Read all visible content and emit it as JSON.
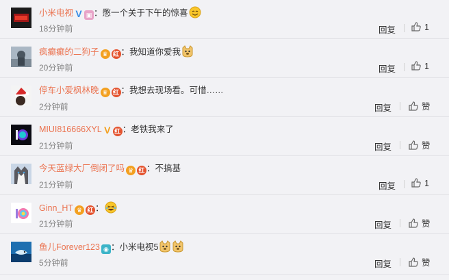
{
  "colors": {
    "username": "#eb7350",
    "text": "#333333",
    "time": "#808080",
    "background": "#f2f2f5"
  },
  "comments": [
    {
      "user": "小米电视",
      "badges": [
        "verified-v-badge",
        "tv-member-badge"
      ],
      "separator": "：",
      "text": "憋一个关于下午的惊喜",
      "emojis": [
        "smile-emoji"
      ],
      "time": "18分钟前",
      "reply_label": "回复",
      "like_count": "1"
    },
    {
      "user": "疯癫癫的二狗子",
      "badges": [
        "crown-badge",
        "red-badge"
      ],
      "separator": "：",
      "text": "我知道你爱我",
      "emojis": [
        "doge-emoji"
      ],
      "time": "20分钟前",
      "reply_label": "回复",
      "like_count": "1"
    },
    {
      "user": "停车小爱枫林晚",
      "badges": [
        "crown-badge",
        "red-badge"
      ],
      "separator": "：",
      "text": "我想去现场看。可惜……",
      "emojis": [],
      "time": "2分钟前",
      "reply_label": "回复",
      "like_label": "赞"
    },
    {
      "user": "MIUI816666XYL",
      "badges": [
        "verified-v-badge",
        "red-badge"
      ],
      "separator": "：",
      "text": "老铁我来了",
      "emojis": [],
      "time": "21分钟前",
      "reply_label": "回复",
      "like_label": "赞"
    },
    {
      "user": "今天蓝绿大厂倒闭了吗",
      "badges": [
        "crown-badge",
        "red-badge"
      ],
      "separator": "：",
      "text": "不搞基",
      "emojis": [],
      "time": "21分钟前",
      "reply_label": "回复",
      "like_count": "1"
    },
    {
      "user": "Ginn_HT",
      "badges": [
        "crown-badge",
        "red-badge"
      ],
      "separator": "：",
      "text": "",
      "emojis": [
        "laugh-emoji"
      ],
      "time": "21分钟前",
      "reply_label": "回复",
      "like_label": "赞"
    },
    {
      "user": "鱼儿Forever123",
      "badges": [
        "camera-badge"
      ],
      "separator": "：",
      "text": "小米电视5",
      "emojis": [
        "doge-emoji",
        "doge-emoji"
      ],
      "time": "5分钟前",
      "reply_label": "回复",
      "like_label": "赞"
    }
  ]
}
